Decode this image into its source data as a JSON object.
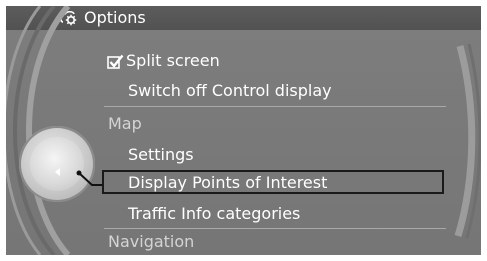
{
  "header": {
    "title": "Options",
    "icon": "options-gear-icon"
  },
  "menu": {
    "split_screen": {
      "label": "Split screen",
      "checked": true
    },
    "switch_off": {
      "label": "Switch off Control display"
    },
    "section_map": {
      "label": "Map"
    },
    "settings": {
      "label": "Settings"
    },
    "display_poi": {
      "label": "Display Points of Interest",
      "selected": true
    },
    "traffic_info": {
      "label": "Traffic Info categories"
    },
    "section_navigation": {
      "label": "Navigation"
    }
  },
  "colors": {
    "background": "#7a7a7a",
    "title_bar": "#555555",
    "text": "#ffffff",
    "section_text": "#d4d4d4",
    "divider": "#a9a9a9",
    "highlight_border": "#1a1a1a"
  }
}
